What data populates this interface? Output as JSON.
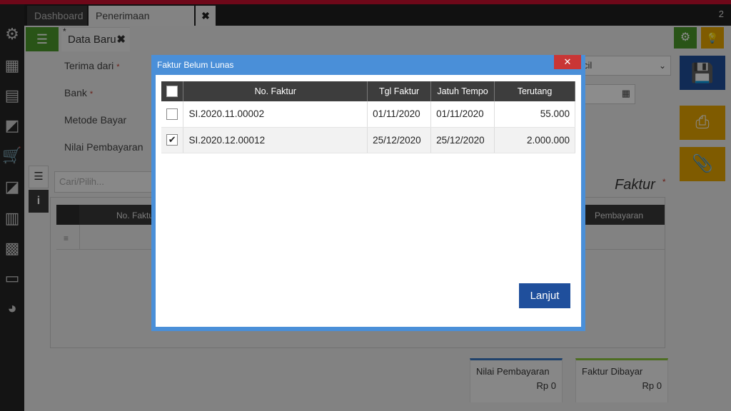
{
  "tabs": {
    "dashboard": "Dashboard",
    "active": "Penerimaan Penjualan",
    "close_glyph": "✖",
    "count": "2"
  },
  "sidebar": {
    "icons": [
      "gear-icon",
      "building-icon",
      "ledger-icon",
      "wallet-icon",
      "cart-icon",
      "bag-plus-icon",
      "cabinet-icon",
      "city-car-icon",
      "cash-icon",
      "pie-chart-icon"
    ]
  },
  "form": {
    "tab_label": "Data Baru",
    "tab_asterisk": "*",
    "tab_close": "✖",
    "fields": {
      "terima_dari": "Terima dari",
      "bank": "Bank",
      "metode_bayar": "Metode Bayar",
      "nilai_pembayaran": "Nilai Pembayaran"
    },
    "required_mark": "*",
    "select_value": "cil",
    "search_placeholder": "Cari/Pilih...",
    "faktur_heading": "Faktur",
    "grid_columns": {
      "no_faktur": "No. Faktur",
      "pembayaran": "Pembayaran"
    },
    "summary": {
      "nilai_pembayaran_label": "Nilai Pembayaran",
      "nilai_pembayaran_value": "Rp 0",
      "faktur_dibayar_label": "Faktur Dibayar",
      "faktur_dibayar_value": "Rp 0"
    }
  },
  "modal": {
    "title": "Faktur Belum Lunas",
    "close_glyph": "✕",
    "columns": [
      "No. Faktur",
      "Tgl Faktur",
      "Jatuh Tempo",
      "Terutang"
    ],
    "rows": [
      {
        "checked": false,
        "no_faktur": "SI.2020.11.00002",
        "tgl_faktur": "01/11/2020",
        "jatuh_tempo": "01/11/2020",
        "terutang": "55.000"
      },
      {
        "checked": true,
        "no_faktur": "SI.2020.12.00012",
        "tgl_faktur": "25/12/2020",
        "jatuh_tempo": "25/12/2020",
        "terutang": "2.000.000"
      }
    ],
    "button": "Lanjut"
  },
  "colors": {
    "top_strip": "#c8102e",
    "green": "#4c9a2a",
    "amber": "#e8a600",
    "navy": "#1f4f9c",
    "modal_frame": "#4a8fd8",
    "close_red": "#c93636"
  }
}
